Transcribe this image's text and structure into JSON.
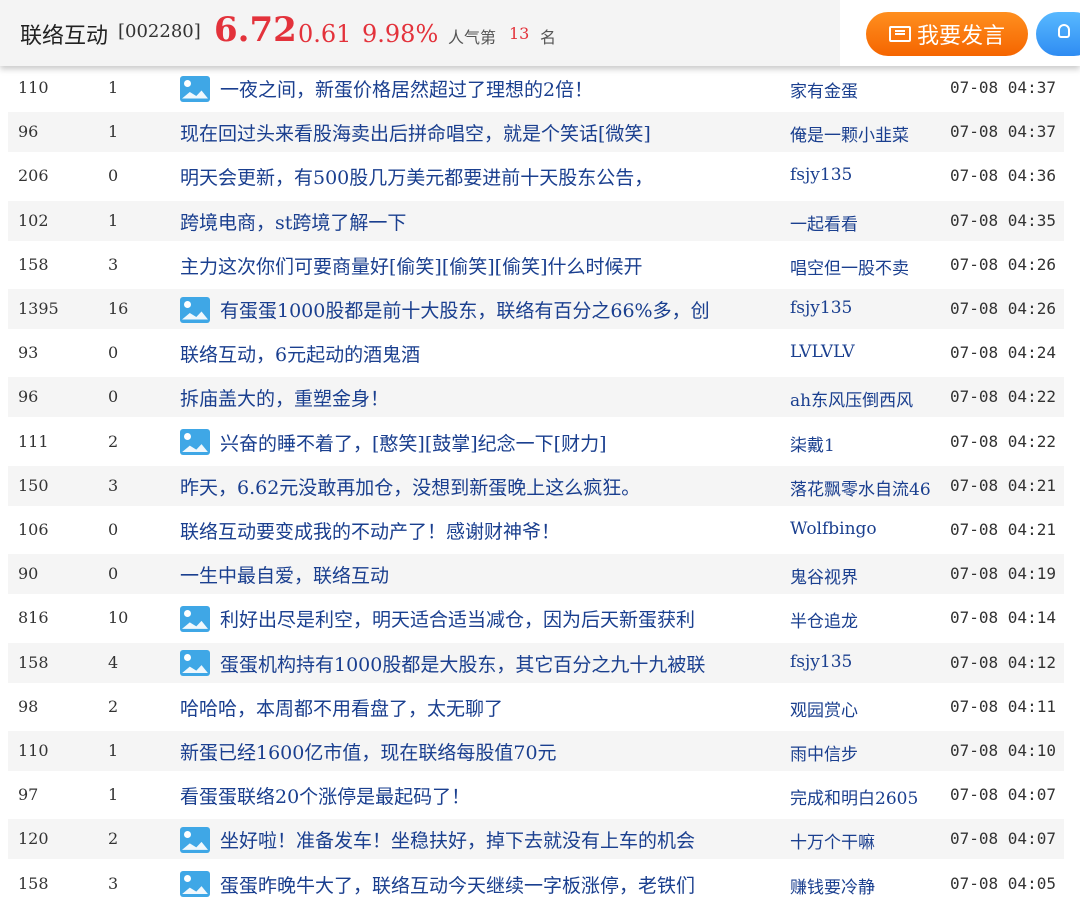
{
  "header": {
    "stock_name": "联络互动",
    "stock_code": "[002280]",
    "price": "6.72",
    "change": "0.61",
    "change_pct": "9.98%",
    "popularity_label": "人气第",
    "popularity_rank": "13",
    "popularity_suffix": "名",
    "post_button_label": "我要发言"
  },
  "colors": {
    "rise": "#e3323b",
    "link": "#1a3f8f",
    "post_button": "#f56500",
    "tip_button": "#2f8cf2",
    "image_icon": "#3fa7e6"
  },
  "posts": [
    {
      "reads": "110",
      "replies": "1",
      "has_image": true,
      "title": "一夜之间，新蛋价格居然超过了理想的2倍！",
      "author": "家有金蛋",
      "time": "07-08 04:37"
    },
    {
      "reads": "96",
      "replies": "1",
      "has_image": false,
      "title": "现在回过头来看股海卖出后拼命唱空，就是个笑话[微笑]",
      "author": "俺是一颗小韭菜",
      "time": "07-08 04:37"
    },
    {
      "reads": "206",
      "replies": "0",
      "has_image": false,
      "title": "明天会更新，有500股几万美元都要进前十天股东公告，",
      "author": "fsjy135",
      "time": "07-08 04:36"
    },
    {
      "reads": "102",
      "replies": "1",
      "has_image": false,
      "title": "跨境电商，st跨境了解一下",
      "author": "一起看看",
      "time": "07-08 04:35"
    },
    {
      "reads": "158",
      "replies": "3",
      "has_image": false,
      "title": "主力这次你们可要商量好[偷笑][偷笑][偷笑]什么时候开",
      "author": "唱空但一股不卖",
      "time": "07-08 04:26"
    },
    {
      "reads": "1395",
      "replies": "16",
      "has_image": true,
      "title": "有蛋蛋1000股都是前十大股东，联络有百分之66%多，创",
      "author": "fsjy135",
      "time": "07-08 04:26"
    },
    {
      "reads": "93",
      "replies": "0",
      "has_image": false,
      "title": "联络互动，6元起动的酒鬼酒",
      "author": "LVLVLV",
      "time": "07-08 04:24"
    },
    {
      "reads": "96",
      "replies": "0",
      "has_image": false,
      "title": "拆庙盖大的，重塑金身！",
      "author": "ah东风压倒西风",
      "time": "07-08 04:22"
    },
    {
      "reads": "111",
      "replies": "2",
      "has_image": true,
      "title": "兴奋的睡不着了，[憨笑][鼓掌]纪念一下[财力]",
      "author": "柒戴1",
      "time": "07-08 04:22"
    },
    {
      "reads": "150",
      "replies": "3",
      "has_image": false,
      "title": "昨天，6.62元没敢再加仓，没想到新蛋晚上这么疯狂。",
      "author": "落花飘零水自流46",
      "time": "07-08 04:21"
    },
    {
      "reads": "106",
      "replies": "0",
      "has_image": false,
      "title": "联络互动要变成我的不动产了！感谢财神爷！",
      "author": "Wolfbingo",
      "time": "07-08 04:21"
    },
    {
      "reads": "90",
      "replies": "0",
      "has_image": false,
      "title": "一生中最自爱，联络互动",
      "author": "鬼谷视界",
      "time": "07-08 04:19"
    },
    {
      "reads": "816",
      "replies": "10",
      "has_image": true,
      "title": "利好出尽是利空，明天适合适当减仓，因为后天新蛋获利",
      "author": "半仓追龙",
      "time": "07-08 04:14"
    },
    {
      "reads": "158",
      "replies": "4",
      "has_image": true,
      "title": "蛋蛋机构持有1000股都是大股东，其它百分之九十九被联",
      "author": "fsjy135",
      "time": "07-08 04:12"
    },
    {
      "reads": "98",
      "replies": "2",
      "has_image": false,
      "title": "哈哈哈，本周都不用看盘了，太无聊了",
      "author": "观园赏心",
      "time": "07-08 04:11"
    },
    {
      "reads": "110",
      "replies": "1",
      "has_image": false,
      "title": "新蛋已经1600亿市值，现在联络每股值70元",
      "author": "雨中信步",
      "time": "07-08 04:10"
    },
    {
      "reads": "97",
      "replies": "1",
      "has_image": false,
      "title": "看蛋蛋联络20个涨停是最起码了！",
      "author": "完成和明白2605",
      "time": "07-08 04:07"
    },
    {
      "reads": "120",
      "replies": "2",
      "has_image": true,
      "title": "坐好啦！准备发车！坐稳扶好，掉下去就没有上车的机会",
      "author": "十万个干嘛",
      "time": "07-08 04:07"
    },
    {
      "reads": "158",
      "replies": "3",
      "has_image": true,
      "title": "蛋蛋昨晚牛大了，联络互动今天继续一字板涨停，老铁们",
      "author": "赚钱要冷静",
      "time": "07-08 04:05"
    }
  ]
}
